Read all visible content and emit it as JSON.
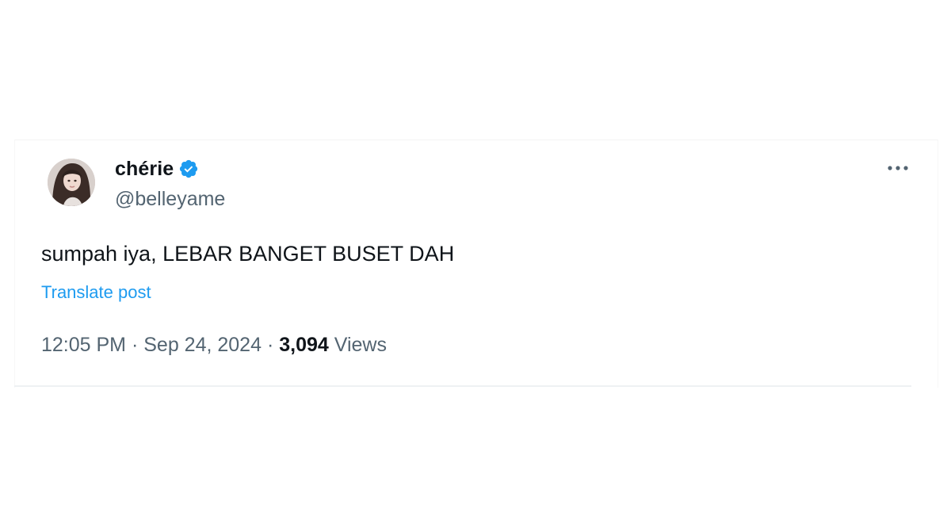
{
  "tweet": {
    "author": {
      "display_name": "chérie",
      "handle": "@belleyame",
      "verified": true,
      "avatar_icon": "profile-photo"
    },
    "text": "sumpah iya, LEBAR BANGET BUSET DAH",
    "translate_label": "Translate post",
    "meta": {
      "time": "12:05 PM",
      "separator": "·",
      "date": "Sep 24, 2024",
      "views_count": "3,094",
      "views_label": "Views"
    },
    "more_icon": "more-horizontal-icon"
  },
  "colors": {
    "text_primary": "#0f1419",
    "text_secondary": "#536471",
    "accent": "#1d9bf0",
    "verified_badge": "#1d9bf0"
  }
}
